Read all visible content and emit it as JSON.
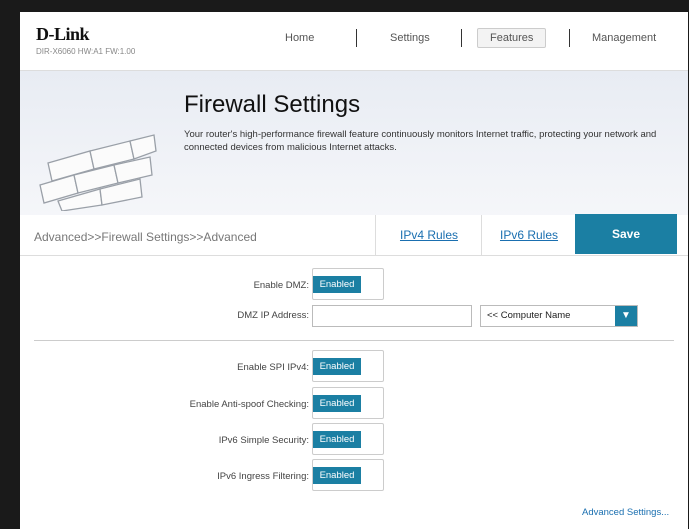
{
  "brand": {
    "logo": "D-Link",
    "firmware": "DIR-X6060 HW:A1 FW:1.00"
  },
  "nav": {
    "home": "Home",
    "settings": "Settings",
    "features": "Features",
    "management": "Management"
  },
  "banner": {
    "title": "Firewall Settings",
    "description": "Your router's high-performance firewall feature continuously monitors Internet traffic, protecting your network and connected devices from malicious Internet attacks."
  },
  "toolbar": {
    "breadcrumb": "Advanced>>Firewall Settings>>Advanced",
    "ipv4_rules": "IPv4 Rules",
    "ipv6_rules": "IPv6 Rules",
    "save": "Save"
  },
  "form": {
    "enable_dmz": {
      "label": "Enable DMZ:",
      "state": "Enabled"
    },
    "dmz_ip": {
      "label": "DMZ IP Address:",
      "value": "",
      "computer_select": "<< Computer Name"
    },
    "enable_spi": {
      "label": "Enable SPI IPv4:",
      "state": "Enabled"
    },
    "anti_spoof": {
      "label": "Enable Anti-spoof Checking:",
      "state": "Enabled"
    },
    "ipv6_simple_security": {
      "label": "IPv6 Simple Security:",
      "state": "Enabled"
    },
    "ipv6_ingress": {
      "label": "IPv6 Ingress Filtering:",
      "state": "Enabled"
    }
  },
  "footer": {
    "advanced_settings": "Advanced Settings..."
  },
  "colors": {
    "accent": "#1b7fa3",
    "link": "#1a6fb0"
  }
}
